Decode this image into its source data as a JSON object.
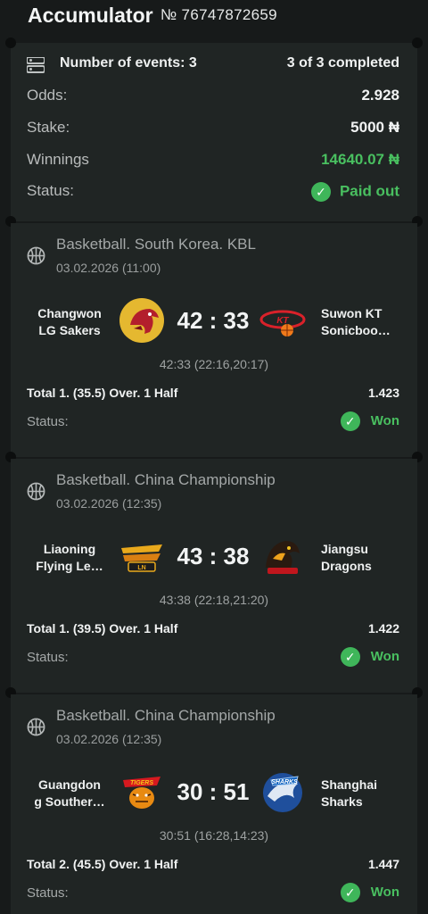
{
  "header": {
    "title": "Accumulator",
    "ticket": "№ 76747872659"
  },
  "summary": {
    "events_label": "Number of events: 3",
    "completed": "3 of 3 completed",
    "odds_label": "Odds:",
    "odds_value": "2.928",
    "stake_label": "Stake:",
    "stake_value": "5000 ₦",
    "winnings_label": "Winnings",
    "winnings_value": "14640.07 ₦",
    "status_label": "Status:",
    "status_value": "Paid out"
  },
  "events": [
    {
      "league": "Basketball. South Korea. KBL",
      "date": "03.02.2026 (11:00)",
      "home_line1": "Changwon",
      "home_line2": "LG Sakers",
      "away_line1": "Suwon KT",
      "away_line2": "Sonicboo…",
      "score": "42 : 33",
      "score_detail": "42:33 (22:16,20:17)",
      "bet": "Total 1. (35.5) Over. 1 Half",
      "odds": "1.423",
      "status_label": "Status:",
      "status": "Won"
    },
    {
      "league": "Basketball. China Championship",
      "date": "03.02.2026 (12:35)",
      "home_line1": "Liaoning",
      "home_line2": "Flying Le…",
      "away_line1": "Jiangsu",
      "away_line2": "Dragons",
      "score": "43 : 38",
      "score_detail": "43:38 (22:18,21:20)",
      "bet": "Total 1. (39.5) Over. 1 Half",
      "odds": "1.422",
      "status_label": "Status:",
      "status": "Won"
    },
    {
      "league": "Basketball. China Championship",
      "date": "03.02.2026 (12:35)",
      "home_line1": "Guangdon",
      "home_line2": "g Souther…",
      "away_line1": "Shanghai",
      "away_line2": "Sharks",
      "score": "30 : 51",
      "score_detail": "30:51 (16:28,14:23)",
      "bet": "Total 2. (45.5) Over. 1 Half",
      "odds": "1.447",
      "status_label": "Status:",
      "status": "Won"
    }
  ],
  "colors": {
    "background": "#171a1a",
    "card": "#202524",
    "accent_green": "#49c060"
  }
}
